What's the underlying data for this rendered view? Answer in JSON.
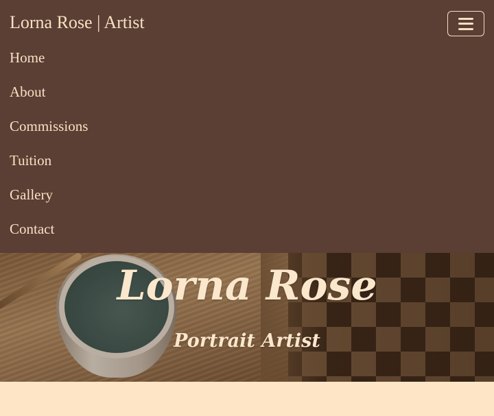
{
  "navbar": {
    "brand": "Lorna Rose | Artist",
    "toggler_icon": "hamburger-menu-icon",
    "items": [
      {
        "label": "Home"
      },
      {
        "label": "About"
      },
      {
        "label": "Commissions"
      },
      {
        "label": "Tuition"
      },
      {
        "label": "Gallery"
      },
      {
        "label": "Contact"
      }
    ]
  },
  "hero": {
    "title": "Lorna Rose",
    "subtitle": "Portrait Artist"
  },
  "colors": {
    "navbar_bg": "#5b3e34",
    "nav_text": "#f6e2c3",
    "page_bg": "#fde5c6",
    "hero_text": "#fbe7cc"
  }
}
